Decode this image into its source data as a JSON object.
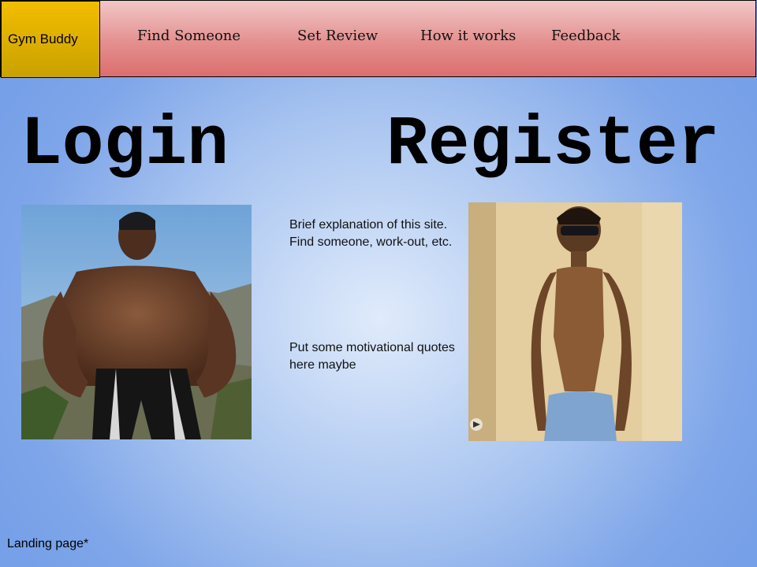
{
  "nav": {
    "brand": "Gym Buddy",
    "items": [
      {
        "label": "Find Someone"
      },
      {
        "label": "Set Review"
      },
      {
        "label": "How it works"
      },
      {
        "label": "Feedback"
      }
    ]
  },
  "main": {
    "login_label": "Login",
    "register_label": "Register",
    "description": "Brief explanation of this site. Find someone, work-out, etc.",
    "quotes_placeholder": "Put some motivational quotes here maybe"
  },
  "footer": {
    "note": "Landing page*"
  },
  "colors": {
    "brand_bg": "#e2b300",
    "nav_bg": "#e48f8f",
    "page_bg": "#9fbdee"
  },
  "images": {
    "left": "muscular-man-photo",
    "right": "skinny-man-photo"
  }
}
